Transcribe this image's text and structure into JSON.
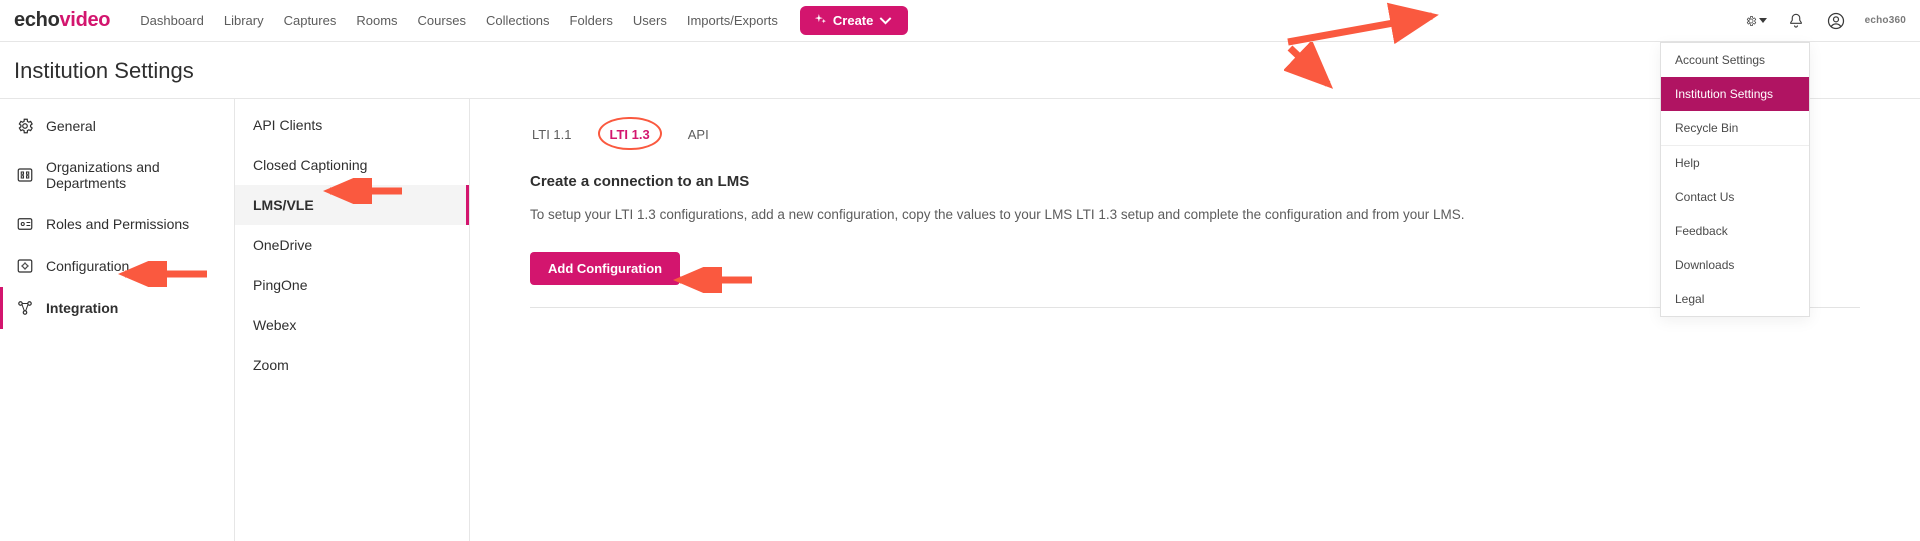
{
  "logo": {
    "part1": "echo",
    "part2": "video"
  },
  "nav": [
    "Dashboard",
    "Library",
    "Captures",
    "Rooms",
    "Courses",
    "Collections",
    "Folders",
    "Users",
    "Imports/Exports"
  ],
  "create_label": "Create",
  "brand_small": "echo360",
  "page_title": "Institution Settings",
  "sidebar_primary": [
    {
      "label": "General",
      "icon": "gear",
      "active": false
    },
    {
      "label": "Organizations and Departments",
      "icon": "org",
      "active": false
    },
    {
      "label": "Roles and Permissions",
      "icon": "roles",
      "active": false
    },
    {
      "label": "Configuration",
      "icon": "config",
      "active": false
    },
    {
      "label": "Integration",
      "icon": "integration",
      "active": true
    }
  ],
  "sidebar_secondary": [
    {
      "label": "API Clients",
      "active": false
    },
    {
      "label": "Closed Captioning",
      "active": false
    },
    {
      "label": "LMS/VLE",
      "active": true
    },
    {
      "label": "OneDrive",
      "active": false
    },
    {
      "label": "PingOne",
      "active": false
    },
    {
      "label": "Webex",
      "active": false
    },
    {
      "label": "Zoom",
      "active": false
    }
  ],
  "tabs": [
    {
      "label": "LTI 1.1",
      "active": false
    },
    {
      "label": "LTI 1.3",
      "active": true
    },
    {
      "label": "API",
      "active": false
    }
  ],
  "main": {
    "heading": "Create a connection to an LMS",
    "description": "To setup your LTI 1.3 configurations, add a new configuration, copy the values to your LMS LTI 1.3 setup and complete the configuration and                                                    from your LMS.",
    "add_button": "Add Configuration"
  },
  "settings_menu": [
    {
      "label": "Account Settings",
      "active": false
    },
    {
      "label": "Institution Settings",
      "active": true
    },
    {
      "label": "Recycle Bin",
      "active": false,
      "sep_after": true
    },
    {
      "label": "Help",
      "active": false
    },
    {
      "label": "Contact Us",
      "active": false
    },
    {
      "label": "Feedback",
      "active": false
    },
    {
      "label": "Downloads",
      "active": false
    },
    {
      "label": "Legal",
      "active": false
    }
  ]
}
